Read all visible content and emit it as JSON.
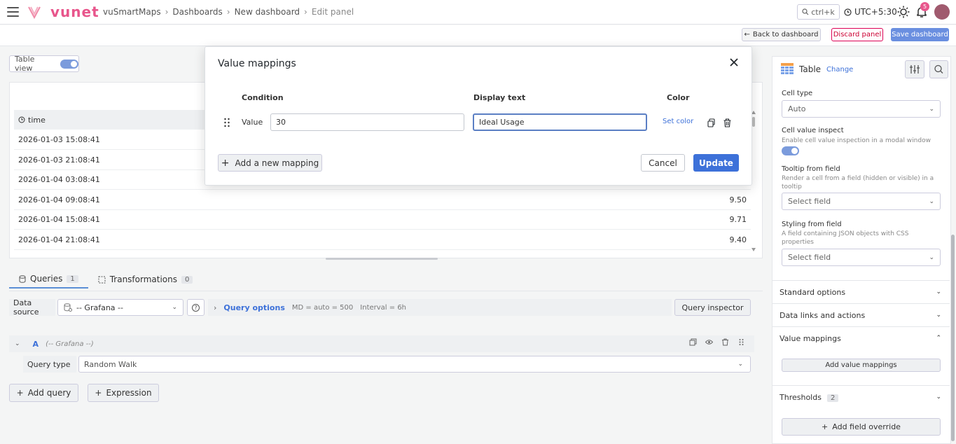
{
  "app": {
    "brand": "vunet"
  },
  "breadcrumb": [
    "vuSmartMaps",
    "Dashboards",
    "New dashboard",
    "Edit panel"
  ],
  "header": {
    "search_placeholder": "ctrl+k",
    "timezone": "UTC+5:30",
    "notifications": "5"
  },
  "toolbar": {
    "back": "Back to dashboard",
    "discard": "Discard panel",
    "save": "Save dashboard"
  },
  "table_view": {
    "label": "Table view",
    "on": true
  },
  "table": {
    "header": "time",
    "rows": [
      {
        "time": "2026-01-03 15:08:41",
        "value": ""
      },
      {
        "time": "2026-01-03 21:08:41",
        "value": ""
      },
      {
        "time": "2026-01-04 03:08:41",
        "value": ""
      },
      {
        "time": "2026-01-04 09:08:41",
        "value": "9.50"
      },
      {
        "time": "2026-01-04 15:08:41",
        "value": "9.71"
      },
      {
        "time": "2026-01-04 21:08:41",
        "value": "9.40"
      }
    ]
  },
  "query_tabs": [
    {
      "label": "Queries",
      "count": "1"
    },
    {
      "label": "Transformations",
      "count": "0"
    }
  ],
  "datasource": {
    "label": "Data source",
    "value": "-- Grafana --"
  },
  "query_options": {
    "label": "Query options",
    "md": "MD = auto = 500",
    "interval": "Interval = 6h",
    "inspector": "Query inspector"
  },
  "query_a": {
    "letter": "A",
    "source": "(-- Grafana --)",
    "type_label": "Query type",
    "type_value": "Random Walk"
  },
  "query_actions": {
    "add": "Add query",
    "expression": "Expression"
  },
  "right_panel": {
    "viz": "Table",
    "change": "Change",
    "cell_type_label": "Cell type",
    "cell_type_value": "Auto",
    "cell_inspect_label": "Cell value inspect",
    "cell_inspect_desc": "Enable cell value inspection in a modal window",
    "tooltip_label": "Tooltip from field",
    "tooltip_desc": "Render a cell from a field (hidden or visible) in a tooltip",
    "tooltip_value": "Select field",
    "styling_label": "Styling from field",
    "styling_desc": "A field containing JSON objects with CSS properties",
    "styling_value": "Select field",
    "sections": {
      "standard": "Standard options",
      "links": "Data links and actions",
      "mappings": "Value mappings",
      "thresholds": "Thresholds",
      "thresholds_count": "2"
    },
    "add_mappings": "Add value mappings",
    "add_override": "Add field override"
  },
  "modal": {
    "title": "Value mappings",
    "col_condition": "Condition",
    "col_display": "Display text",
    "col_color": "Color",
    "row": {
      "type": "Value",
      "value": "30",
      "display": "Ideal Usage",
      "color_action": "Set color"
    },
    "add_mapping": "Add a new mapping",
    "cancel": "Cancel",
    "update": "Update"
  },
  "colors": {
    "brand": "#e8568c",
    "primary": "#3d71d9",
    "focus": "#5b7fc4"
  }
}
